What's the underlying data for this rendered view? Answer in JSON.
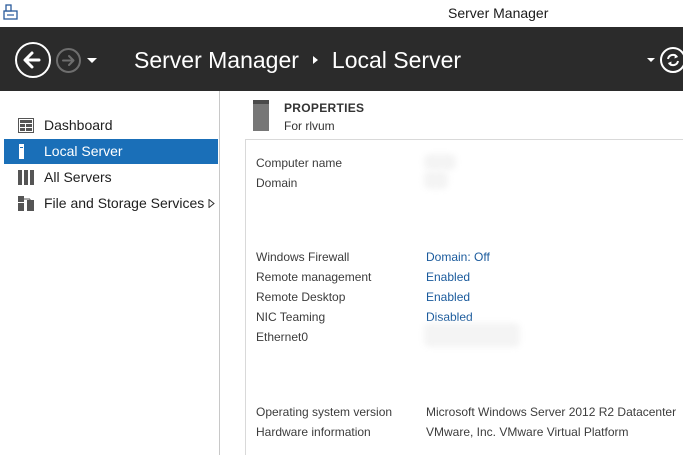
{
  "window": {
    "title": "Server Manager"
  },
  "header": {
    "crumbs": [
      "Server Manager",
      "Local Server"
    ],
    "icons": {
      "back": "back-arrow-icon",
      "forward": "forward-arrow-icon",
      "refresh": "refresh-icon"
    }
  },
  "nav": {
    "items": [
      {
        "label": "Dashboard",
        "icon": "dashboard-icon",
        "selected": false
      },
      {
        "label": "Local Server",
        "icon": "local-server-icon",
        "selected": true
      },
      {
        "label": "All Servers",
        "icon": "all-servers-icon",
        "selected": false
      },
      {
        "label": "File and Storage Services",
        "icon": "file-storage-icon",
        "selected": false
      }
    ]
  },
  "properties": {
    "title": "PROPERTIES",
    "subtitle": "For rlvum",
    "rows": [
      {
        "label": "Computer name",
        "value": ""
      },
      {
        "label": "Domain",
        "value": ""
      },
      {
        "label": "Windows Firewall",
        "value": "Domain: Off"
      },
      {
        "label": "Remote management",
        "value": "Enabled"
      },
      {
        "label": "Remote Desktop",
        "value": "Enabled"
      },
      {
        "label": "NIC Teaming",
        "value": "Disabled"
      },
      {
        "label": "Ethernet0",
        "value": ""
      },
      {
        "label": "Operating system version",
        "value": "Microsoft Windows Server 2012 R2 Datacenter"
      },
      {
        "label": "Hardware information",
        "value": "VMware, Inc. VMware Virtual Platform"
      }
    ]
  },
  "colors": {
    "accent": "#1a6fb8",
    "header_bg": "#2b2b2b",
    "link": "#1a5a9c"
  }
}
